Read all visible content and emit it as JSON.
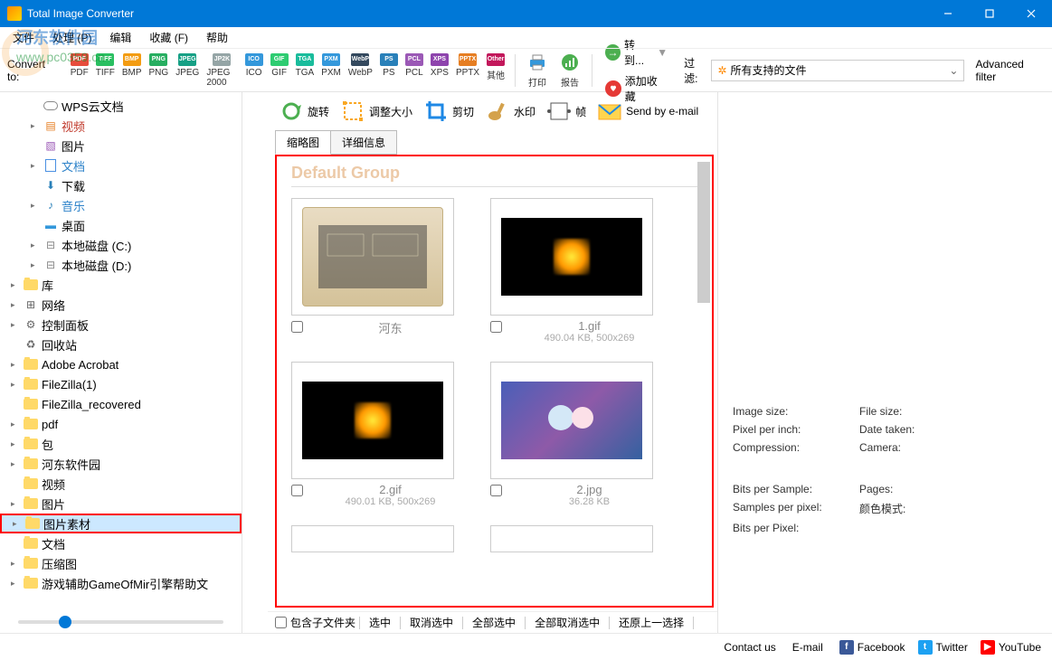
{
  "title": "Total Image Converter",
  "watermark": {
    "line1": "河东软件园",
    "line2": "www.pc0359.cn"
  },
  "menu": [
    "文件",
    "处理 (P)",
    "编辑",
    "收藏 (F)",
    "帮助"
  ],
  "toolbar": {
    "convert_label": "Convert to:",
    "formats": [
      {
        "l": "PDF",
        "c": "#e74c3c"
      },
      {
        "l": "TIFF",
        "c": "#2abf61"
      },
      {
        "l": "BMP",
        "c": "#f39c12"
      },
      {
        "l": "PNG",
        "c": "#27ae60"
      },
      {
        "l": "JPEG",
        "c": "#16a085"
      },
      {
        "l": "JPEG 2000",
        "c": "#95a5a6",
        "sl": "JP2K"
      },
      {
        "l": "ICO",
        "c": "#3498db"
      },
      {
        "l": "GIF",
        "c": "#2ecc71"
      },
      {
        "l": "TGA",
        "c": "#1abc9c"
      },
      {
        "l": "PXM",
        "c": "#3498db"
      },
      {
        "l": "WebP",
        "c": "#34495e"
      },
      {
        "l": "PS",
        "c": "#2980b9"
      },
      {
        "l": "PCL",
        "c": "#9b59b6"
      },
      {
        "l": "XPS",
        "c": "#8e44ad"
      },
      {
        "l": "PPTX",
        "c": "#e67e22"
      },
      {
        "l": "其他",
        "c": "#c2185b",
        "sl": "Other"
      }
    ],
    "tools": [
      {
        "key": "print",
        "l": "打印"
      },
      {
        "key": "report",
        "l": "报告"
      }
    ],
    "transfer": "转到...",
    "favorite": "添加收藏",
    "filter_label": "过滤:",
    "filter_value": "所有支持的文件",
    "advanced_filter": "Advanced filter"
  },
  "sidebar": {
    "items": [
      {
        "lvl": 1,
        "arrow": "",
        "icon": "cloud",
        "label": "WPS云文档"
      },
      {
        "lvl": 1,
        "arrow": "▸",
        "icon": "vid",
        "label": "视频",
        "color": "#c0392b"
      },
      {
        "lvl": 1,
        "arrow": "",
        "icon": "pic",
        "label": "图片"
      },
      {
        "lvl": 1,
        "arrow": "▸",
        "icon": "doc",
        "label": "文档",
        "color": "#2c82c9"
      },
      {
        "lvl": 1,
        "arrow": "",
        "icon": "dl",
        "label": "下载"
      },
      {
        "lvl": 1,
        "arrow": "▸",
        "icon": "music",
        "label": "音乐",
        "color": "#2c82c9"
      },
      {
        "lvl": 1,
        "arrow": "",
        "icon": "desk",
        "label": "桌面"
      },
      {
        "lvl": 1,
        "arrow": "▸",
        "icon": "disk",
        "label": "本地磁盘 (C:)"
      },
      {
        "lvl": 1,
        "arrow": "▸",
        "icon": "disk",
        "label": "本地磁盘 (D:)"
      },
      {
        "lvl": 0,
        "arrow": "▸",
        "icon": "fld",
        "label": "库"
      },
      {
        "lvl": 0,
        "arrow": "▸",
        "icon": "net",
        "label": "网络"
      },
      {
        "lvl": 0,
        "arrow": "▸",
        "icon": "ctrl",
        "label": "控制面板"
      },
      {
        "lvl": 0,
        "arrow": "",
        "icon": "trash",
        "label": "回收站"
      },
      {
        "lvl": 0,
        "arrow": "▸",
        "icon": "fld",
        "label": "Adobe Acrobat"
      },
      {
        "lvl": 0,
        "arrow": "▸",
        "icon": "fld",
        "label": "FileZilla(1)"
      },
      {
        "lvl": 0,
        "arrow": "",
        "icon": "fld",
        "label": "FileZilla_recovered"
      },
      {
        "lvl": 0,
        "arrow": "▸",
        "icon": "fld",
        "label": "pdf"
      },
      {
        "lvl": 0,
        "arrow": "▸",
        "icon": "fld",
        "label": "包"
      },
      {
        "lvl": 0,
        "arrow": "▸",
        "icon": "fld",
        "label": "河东软件园"
      },
      {
        "lvl": 0,
        "arrow": "",
        "icon": "fld",
        "label": "视频"
      },
      {
        "lvl": 0,
        "arrow": "▸",
        "icon": "fld",
        "label": "图片"
      },
      {
        "lvl": 0,
        "arrow": "▸",
        "icon": "fld",
        "label": "图片素材",
        "selected": true,
        "highlighted": true
      },
      {
        "lvl": 0,
        "arrow": "",
        "icon": "fld",
        "label": "文档"
      },
      {
        "lvl": 0,
        "arrow": "▸",
        "icon": "fld",
        "label": "压缩图"
      },
      {
        "lvl": 0,
        "arrow": "▸",
        "icon": "fld",
        "label": "游戏辅助GameOfMir引擎帮助文"
      }
    ]
  },
  "main_tools": [
    {
      "key": "rotate",
      "l": "旋转"
    },
    {
      "key": "resize",
      "l": "调整大小"
    },
    {
      "key": "crop",
      "l": "剪切"
    },
    {
      "key": "watermark",
      "l": "水印"
    },
    {
      "key": "frame",
      "l": "帧"
    },
    {
      "key": "email",
      "l": "Send by e-mail"
    }
  ],
  "tabs": {
    "thumb": "缩略图",
    "detail": "详细信息"
  },
  "group_title": "Default Group",
  "thumbnails": [
    {
      "name": "河东",
      "info": "",
      "type": "folder"
    },
    {
      "name": "1.gif",
      "info": "490.04 KB, 500x269",
      "type": "flame"
    },
    {
      "name": "2.gif",
      "info": "490.01 KB, 500x269",
      "type": "flame"
    },
    {
      "name": "2.jpg",
      "info": "36.28 KB",
      "type": "anime"
    }
  ],
  "bottom": [
    "包含子文件夹",
    "选中",
    "取消选中",
    "全部选中",
    "全部取消选中",
    "还原上一选择"
  ],
  "right": [
    {
      "l": "Image size:",
      "v": "",
      "r": "File size:"
    },
    {
      "l": "Pixel per inch:",
      "v": "",
      "r": "Date taken:"
    },
    {
      "l": "Compression:",
      "v": "",
      "r": "Camera:"
    },
    null,
    {
      "l": "Bits per Sample:",
      "v": "",
      "r": "Pages:"
    },
    {
      "l": "Samples per pixel:",
      "v": "",
      "r": "颜色模式:"
    },
    {
      "l": "Bits per Pixel:",
      "v": "",
      "r": ""
    }
  ],
  "statusbar": {
    "contact": "Contact us",
    "email": "E-mail",
    "socials": [
      {
        "l": "Facebook",
        "c": "#3b5998",
        "i": "f"
      },
      {
        "l": "Twitter",
        "c": "#1da1f2",
        "i": "t"
      },
      {
        "l": "YouTube",
        "c": "#ff0000",
        "i": "▶"
      }
    ]
  }
}
